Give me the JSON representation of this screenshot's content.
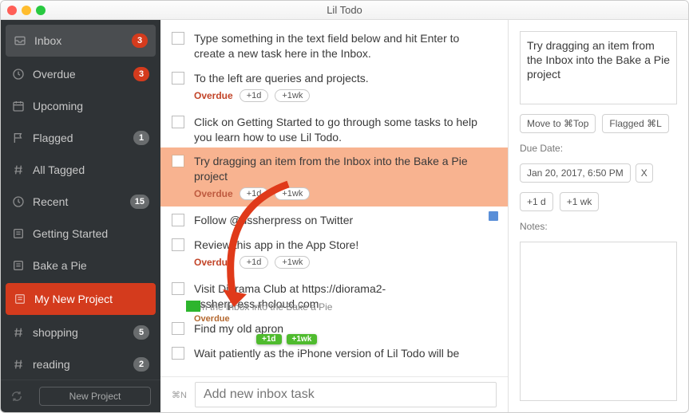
{
  "title": "Lil Todo",
  "sidebar": {
    "items": [
      {
        "label": "Inbox",
        "badge": "3",
        "badgeRed": true,
        "selected": true,
        "icon": "inbox"
      },
      {
        "label": "Overdue",
        "badge": "3",
        "badgeRed": true,
        "icon": "clock"
      },
      {
        "label": "Upcoming",
        "icon": "calendar"
      },
      {
        "label": "Flagged",
        "badge": "1",
        "icon": "flag"
      },
      {
        "label": "All Tagged",
        "icon": "hash"
      },
      {
        "label": "Recent",
        "badge": "15",
        "icon": "clock"
      },
      {
        "label": "Getting Started",
        "icon": "list"
      },
      {
        "label": "Bake a Pie",
        "icon": "list"
      },
      {
        "label": "My New Project",
        "icon": "list",
        "drop": true
      },
      {
        "label": "shopping",
        "badge": "5",
        "icon": "hash"
      },
      {
        "label": "reading",
        "badge": "2",
        "icon": "hash"
      }
    ],
    "newproj": "New Project"
  },
  "tasks": [
    {
      "text": "Type something in the text field below and hit Enter to create a new task here in the Inbox."
    },
    {
      "text": "To the left are queries and projects.",
      "overdue": true
    },
    {
      "text": "Click on Getting Started to go through some tasks to help you learn how to use Lil Todo."
    },
    {
      "text": "Try dragging an item from the Inbox into the Bake a Pie project",
      "overdue": true,
      "selected": true
    },
    {
      "text": "Follow @ussherpress on Twitter",
      "flag": true
    },
    {
      "text": "Review this app in the App Store!",
      "overdue": true
    },
    {
      "text": "Visit Diorama Club at https://diorama2-ussherpress.rhcloud.com"
    },
    {
      "text": "Find my old apron"
    },
    {
      "text": "Wait patiently as the iPhone version of Lil Todo will be"
    }
  ],
  "metaPills": {
    "overdue": "Overdue",
    "plus1d": "+1d",
    "plus1wk": "+1wk"
  },
  "addRow": {
    "hint": "⌘N",
    "placeholder": "Add new inbox task"
  },
  "details": {
    "text": "Try dragging an item from the Inbox into the Bake a Pie project",
    "moveTop": "Move to ⌘Top",
    "flagged": "Flagged ⌘L",
    "dueLabel": "Due Date:",
    "dueDate": "Jan 20, 2017, 6:50 PM",
    "clear": "X",
    "plus1d": "+1 d",
    "plus1wk": "+1 wk",
    "notesLabel": "Notes:"
  },
  "ghost": {
    "text": "om the Inbox into the Bake a Pie",
    "overdue": "Overdue",
    "p1": "+1d",
    "p2": "+1wk"
  }
}
